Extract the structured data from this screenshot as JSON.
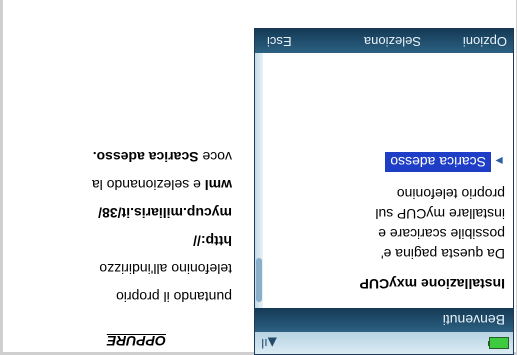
{
  "phone": {
    "title": "Benvenuti",
    "signal_glyph": "▲ıl",
    "page_heading": "Installazione mxyCUP",
    "body_lines": [
      "Da questa pagina e'",
      "possibile scaricare e",
      "installare myCUP sul",
      "proprio telefonino"
    ],
    "download_link": "Scarica adesso",
    "softkeys": {
      "left": "Opzioni",
      "middle": "Seleziona",
      "right": "Esci"
    },
    "colors": {
      "bar_dark": "#143a56",
      "link_bg": "#1f3ec7",
      "battery": "#3fcb3f"
    }
  },
  "aside": {
    "heading": "OPPURE",
    "lines": [
      {
        "parts": [
          {
            "text": "puntando il proprio",
            "bold": false
          }
        ]
      },
      {
        "parts": [
          {
            "text": "telefonino all'indirizzo",
            "bold": false
          }
        ]
      },
      {
        "parts": [
          {
            "text": "http://",
            "bold": true
          }
        ]
      },
      {
        "parts": [
          {
            "text": "mycup.miliaris.it/38/",
            "bold": true
          }
        ]
      },
      {
        "parts": [
          {
            "text": "wml",
            "bold": true
          },
          {
            "text": " e selezionando la",
            "bold": false
          }
        ]
      },
      {
        "parts": [
          {
            "text": "voce ",
            "bold": false
          },
          {
            "text": "Scarica adesso.",
            "bold": true
          }
        ]
      }
    ]
  }
}
